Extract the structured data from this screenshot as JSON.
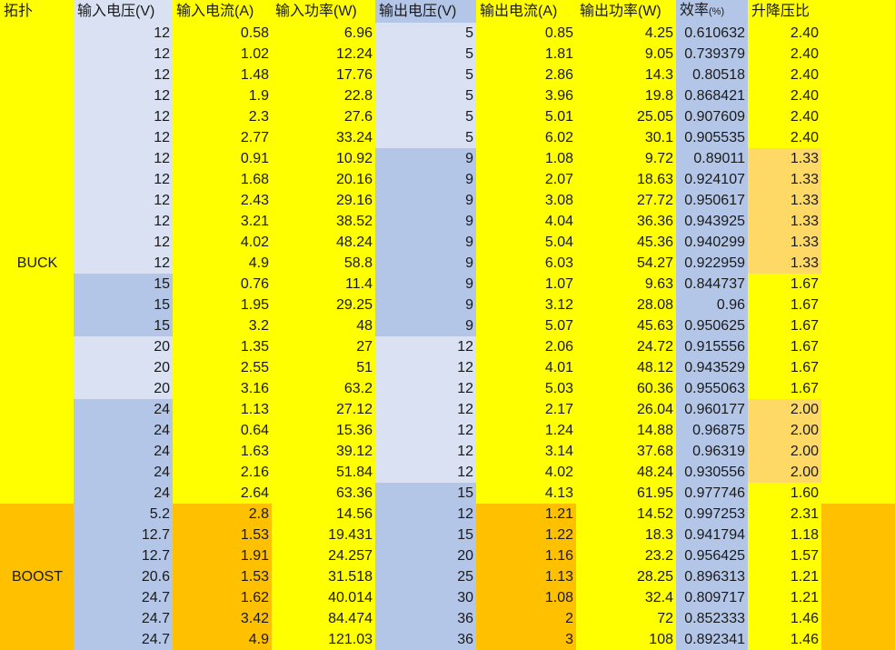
{
  "headers": {
    "topology": "拓扑",
    "vin": "输入电压(V)",
    "iin": "输入电流(A)",
    "pin": "输入功率(W)",
    "vout": "输出电压(V)",
    "iout": "输出电流(A)",
    "pout": "输出功率(W)",
    "eff": "效率",
    "eff_unit": "(%)",
    "ratio": "升降压比"
  },
  "groups": [
    {
      "name": "BUCK",
      "rows": 23
    },
    {
      "name": "BOOST",
      "rows": 7
    }
  ],
  "colors": {
    "yellow": "#ffff00",
    "light_blue": "#d9e1f2",
    "blue": "#b4c6e7",
    "orange": "#ffc000",
    "peach": "#ffd966"
  },
  "rows": [
    {
      "vin": "12",
      "iin": "0.58",
      "pin": "6.96",
      "vout": "5",
      "iout": "0.85",
      "pout": "4.25",
      "eff": "0.610632",
      "ratio": "2.40"
    },
    {
      "vin": "12",
      "iin": "1.02",
      "pin": "12.24",
      "vout": "5",
      "iout": "1.81",
      "pout": "9.05",
      "eff": "0.739379",
      "ratio": "2.40"
    },
    {
      "vin": "12",
      "iin": "1.48",
      "pin": "17.76",
      "vout": "5",
      "iout": "2.86",
      "pout": "14.3",
      "eff": "0.80518",
      "ratio": "2.40"
    },
    {
      "vin": "12",
      "iin": "1.9",
      "pin": "22.8",
      "vout": "5",
      "iout": "3.96",
      "pout": "19.8",
      "eff": "0.868421",
      "ratio": "2.40"
    },
    {
      "vin": "12",
      "iin": "2.3",
      "pin": "27.6",
      "vout": "5",
      "iout": "5.01",
      "pout": "25.05",
      "eff": "0.907609",
      "ratio": "2.40"
    },
    {
      "vin": "12",
      "iin": "2.77",
      "pin": "33.24",
      "vout": "5",
      "iout": "6.02",
      "pout": "30.1",
      "eff": "0.905535",
      "ratio": "2.40"
    },
    {
      "vin": "12",
      "iin": "0.91",
      "pin": "10.92",
      "vout": "9",
      "iout": "1.08",
      "pout": "9.72",
      "eff": "0.89011",
      "ratio": "1.33"
    },
    {
      "vin": "12",
      "iin": "1.68",
      "pin": "20.16",
      "vout": "9",
      "iout": "2.07",
      "pout": "18.63",
      "eff": "0.924107",
      "ratio": "1.33"
    },
    {
      "vin": "12",
      "iin": "2.43",
      "pin": "29.16",
      "vout": "9",
      "iout": "3.08",
      "pout": "27.72",
      "eff": "0.950617",
      "ratio": "1.33"
    },
    {
      "vin": "12",
      "iin": "3.21",
      "pin": "38.52",
      "vout": "9",
      "iout": "4.04",
      "pout": "36.36",
      "eff": "0.943925",
      "ratio": "1.33"
    },
    {
      "vin": "12",
      "iin": "4.02",
      "pin": "48.24",
      "vout": "9",
      "iout": "5.04",
      "pout": "45.36",
      "eff": "0.940299",
      "ratio": "1.33"
    },
    {
      "vin": "12",
      "iin": "4.9",
      "pin": "58.8",
      "vout": "9",
      "iout": "6.03",
      "pout": "54.27",
      "eff": "0.922959",
      "ratio": "1.33"
    },
    {
      "vin": "15",
      "iin": "0.76",
      "pin": "11.4",
      "vout": "9",
      "iout": "1.07",
      "pout": "9.63",
      "eff": "0.844737",
      "ratio": "1.67"
    },
    {
      "vin": "15",
      "iin": "1.95",
      "pin": "29.25",
      "vout": "9",
      "iout": "3.12",
      "pout": "28.08",
      "eff": "0.96",
      "ratio": "1.67"
    },
    {
      "vin": "15",
      "iin": "3.2",
      "pin": "48",
      "vout": "9",
      "iout": "5.07",
      "pout": "45.63",
      "eff": "0.950625",
      "ratio": "1.67"
    },
    {
      "vin": "20",
      "iin": "1.35",
      "pin": "27",
      "vout": "12",
      "iout": "2.06",
      "pout": "24.72",
      "eff": "0.915556",
      "ratio": "1.67"
    },
    {
      "vin": "20",
      "iin": "2.55",
      "pin": "51",
      "vout": "12",
      "iout": "4.01",
      "pout": "48.12",
      "eff": "0.943529",
      "ratio": "1.67"
    },
    {
      "vin": "20",
      "iin": "3.16",
      "pin": "63.2",
      "vout": "12",
      "iout": "5.03",
      "pout": "60.36",
      "eff": "0.955063",
      "ratio": "1.67"
    },
    {
      "vin": "24",
      "iin": "1.13",
      "pin": "27.12",
      "vout": "12",
      "iout": "2.17",
      "pout": "26.04",
      "eff": "0.960177",
      "ratio": "2.00"
    },
    {
      "vin": "24",
      "iin": "0.64",
      "pin": "15.36",
      "vout": "12",
      "iout": "1.24",
      "pout": "14.88",
      "eff": "0.96875",
      "ratio": "2.00"
    },
    {
      "vin": "24",
      "iin": "1.63",
      "pin": "39.12",
      "vout": "12",
      "iout": "3.14",
      "pout": "37.68",
      "eff": "0.96319",
      "ratio": "2.00"
    },
    {
      "vin": "24",
      "iin": "2.16",
      "pin": "51.84",
      "vout": "12",
      "iout": "4.02",
      "pout": "48.24",
      "eff": "0.930556",
      "ratio": "2.00"
    },
    {
      "vin": "24",
      "iin": "2.64",
      "pin": "63.36",
      "vout": "15",
      "iout": "4.13",
      "pout": "61.95",
      "eff": "0.977746",
      "ratio": "1.60"
    },
    {
      "vin": "5.2",
      "iin": "2.8",
      "pin": "14.56",
      "vout": "12",
      "iout": "1.21",
      "pout": "14.52",
      "eff": "0.997253",
      "ratio": "2.31"
    },
    {
      "vin": "12.7",
      "iin": "1.53",
      "pin": "19.431",
      "vout": "15",
      "iout": "1.22",
      "pout": "18.3",
      "eff": "0.941794",
      "ratio": "1.18"
    },
    {
      "vin": "12.7",
      "iin": "1.91",
      "pin": "24.257",
      "vout": "20",
      "iout": "1.16",
      "pout": "23.2",
      "eff": "0.956425",
      "ratio": "1.57"
    },
    {
      "vin": "20.6",
      "iin": "1.53",
      "pin": "31.518",
      "vout": "25",
      "iout": "1.13",
      "pout": "28.25",
      "eff": "0.896313",
      "ratio": "1.21"
    },
    {
      "vin": "24.7",
      "iin": "1.62",
      "pin": "40.014",
      "vout": "30",
      "iout": "1.08",
      "pout": "32.4",
      "eff": "0.809717",
      "ratio": "1.21"
    },
    {
      "vin": "24.7",
      "iin": "3.42",
      "pin": "84.474",
      "vout": "36",
      "iout": "2",
      "pout": "72",
      "eff": "0.852333",
      "ratio": "1.46"
    },
    {
      "vin": "24.7",
      "iin": "4.9",
      "pin": "121.03",
      "vout": "36",
      "iout": "3",
      "pout": "108",
      "eff": "0.892341",
      "ratio": "1.46"
    }
  ]
}
